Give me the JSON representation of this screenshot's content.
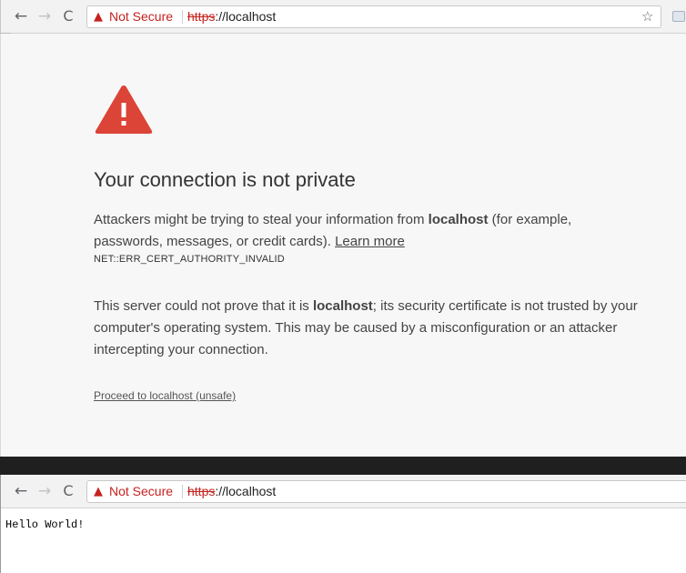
{
  "browser_top": {
    "security_label": "Not Secure",
    "url_scheme": "https",
    "url_rest": "://localhost"
  },
  "interstitial": {
    "heading": "Your connection is not private",
    "paragraph1_before": "Attackers might be trying to steal your information from ",
    "paragraph1_host": "localhost",
    "paragraph1_after": " (for example, passwords, messages, or credit cards). ",
    "learn_more": "Learn more",
    "error_code": "NET::ERR_CERT_AUTHORITY_INVALID",
    "paragraph2_before": "This server could not prove that it is ",
    "paragraph2_host": "localhost",
    "paragraph2_after": "; its security certificate is not trusted by your computer's operating system. This may be caused by a misconfiguration or an attacker intercepting your connection.",
    "proceed_link": "Proceed to localhost (unsafe)"
  },
  "browser_bottom": {
    "security_label": "Not Secure",
    "url_scheme": "https",
    "url_rest": "://localhost",
    "page_text": "Hello World!"
  },
  "icons": {
    "back": "back-arrow-icon",
    "forward": "forward-arrow-icon",
    "reload": "reload-icon",
    "warning": "warning-triangle-icon",
    "star": "bookmark-star-icon",
    "extension": "extension-icon",
    "alert": "red-alert-triangle-icon"
  },
  "colors": {
    "insecure_red": "#c5221f",
    "alert_red": "#db4437",
    "interstitial_bg": "#f7f7f7",
    "toolbar_bg": "#f2f2f2"
  }
}
